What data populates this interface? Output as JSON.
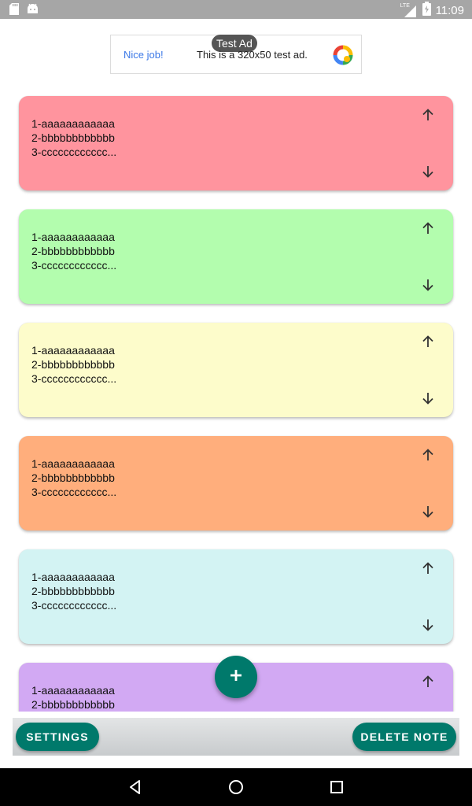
{
  "status_bar": {
    "time": "11:09",
    "network_label": "LTE",
    "icons": [
      "sd-card-icon",
      "android-icon",
      "signal-icon",
      "battery-icon"
    ]
  },
  "ad": {
    "badge": "Test Ad",
    "nice_text": "Nice job!",
    "body_text": "This is a 320x50 test ad."
  },
  "notes": [
    {
      "lines": [
        "1-aaaaaaaaaaaa",
        "2-bbbbbbbbbbbb",
        "3-cccccccccccc..."
      ],
      "color": "#ff949e"
    },
    {
      "lines": [
        "1-aaaaaaaaaaaa",
        "2-bbbbbbbbbbbb",
        "3-cccccccccccc..."
      ],
      "color": "#b3fdae"
    },
    {
      "lines": [
        "1-aaaaaaaaaaaa",
        "2-bbbbbbbbbbbb",
        "3-cccccccccccc..."
      ],
      "color": "#fdfccb"
    },
    {
      "lines": [
        "1-aaaaaaaaaaaa",
        "2-bbbbbbbbbbbb",
        "3-cccccccccccc..."
      ],
      "color": "#ffae7c"
    },
    {
      "lines": [
        "1-aaaaaaaaaaaa",
        "2-bbbbbbbbbbbb",
        "3-cccccccccccc..."
      ],
      "color": "#d3f3f3"
    },
    {
      "lines": [
        "1-aaaaaaaaaaaa",
        "2-bbbbbbbbbbbb"
      ],
      "color": "#d2a9f3"
    }
  ],
  "fab": {
    "icon": "plus-icon"
  },
  "bottom_bar": {
    "settings_label": "SETTINGS",
    "delete_label": "DELETE NOTE"
  },
  "nav_bar": {
    "icons": [
      "back-icon",
      "home-icon",
      "recents-icon"
    ]
  },
  "colors": {
    "accent": "#00796b",
    "status_bar": "#a6a6a6",
    "ad_link": "#3b78e7"
  }
}
